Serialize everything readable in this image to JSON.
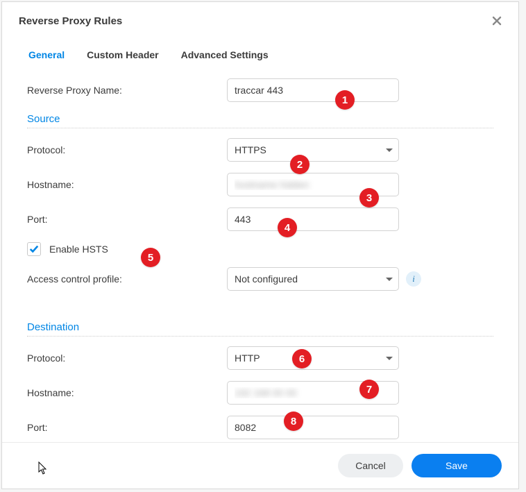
{
  "dialog": {
    "title": "Reverse Proxy Rules"
  },
  "tabs": {
    "general": "General",
    "custom_header": "Custom Header",
    "advanced": "Advanced Settings"
  },
  "fields": {
    "name_label": "Reverse Proxy Name:",
    "name_value": "traccar 443",
    "protocol_label": "Protocol:",
    "hostname_label": "Hostname:",
    "port_label": "Port:",
    "enable_hsts_label": "Enable HSTS",
    "access_profile_label": "Access control profile:",
    "access_profile_value": "Not configured"
  },
  "sections": {
    "source": "Source",
    "destination": "Destination"
  },
  "source": {
    "protocol": "HTTPS",
    "hostname": "hostname hidden",
    "port": "443",
    "hsts_checked": true
  },
  "destination": {
    "protocol": "HTTP",
    "hostname": "192 168 00 00",
    "port": "8082"
  },
  "footer": {
    "cancel": "Cancel",
    "save": "Save"
  },
  "markers": {
    "m1": "1",
    "m2": "2",
    "m3": "3",
    "m4": "4",
    "m5": "5",
    "m6": "6",
    "m7": "7",
    "m8": "8"
  }
}
